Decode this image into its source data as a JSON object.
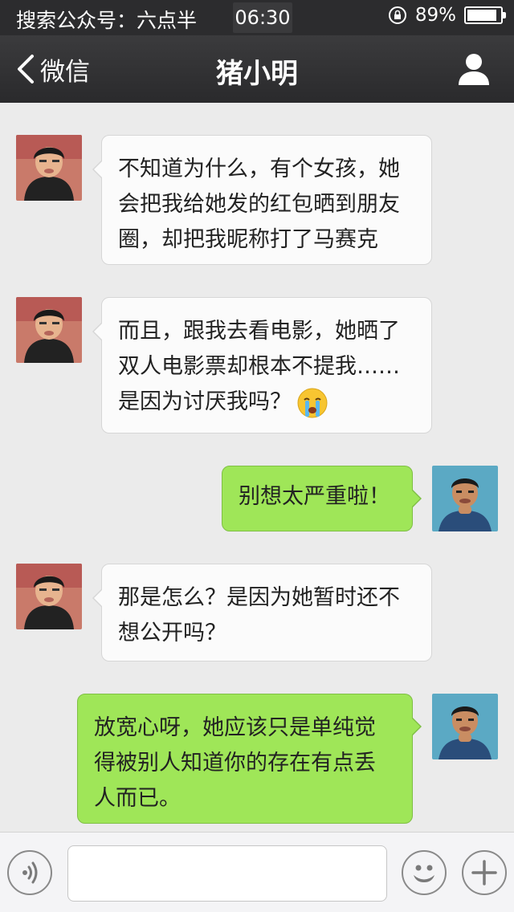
{
  "status_bar": {
    "left_text": "搜索公众号：六点半",
    "time": "06:30",
    "battery_text": "89%",
    "battery_level": 0.89,
    "icons": [
      "rotation-lock-icon",
      "battery-icon"
    ]
  },
  "nav": {
    "back_label": "微信",
    "title": "猪小明",
    "icons": [
      "chevron-left-icon",
      "person-icon"
    ]
  },
  "messages": [
    {
      "side": "in",
      "text": "不知道为什么，有个女孩，她会把我给她发的红包晒到朋友圈，却把我昵称打了马赛克"
    },
    {
      "side": "in",
      "text": "而且，跟我去看电影，她晒了双人电影票却根本不提我……是因为讨厌我吗？",
      "trailing_emoji": "crying-face-emoji"
    },
    {
      "side": "out",
      "text": "别想太严重啦！"
    },
    {
      "side": "in",
      "text": "那是怎么？是因为她暂时还不想公开吗？"
    },
    {
      "side": "out",
      "text": "放宽心呀，她应该只是单纯觉得被别人知道你的存在有点丢人而已。"
    }
  ],
  "input_bar": {
    "value": "",
    "icons": [
      "voice-icon",
      "smiley-icon",
      "plus-icon"
    ]
  },
  "colors": {
    "background": "#ebebeb",
    "navbar": "#2e2e30",
    "incoming_bubble": "#fbfbfb",
    "outgoing_bubble": "#9fe658"
  }
}
